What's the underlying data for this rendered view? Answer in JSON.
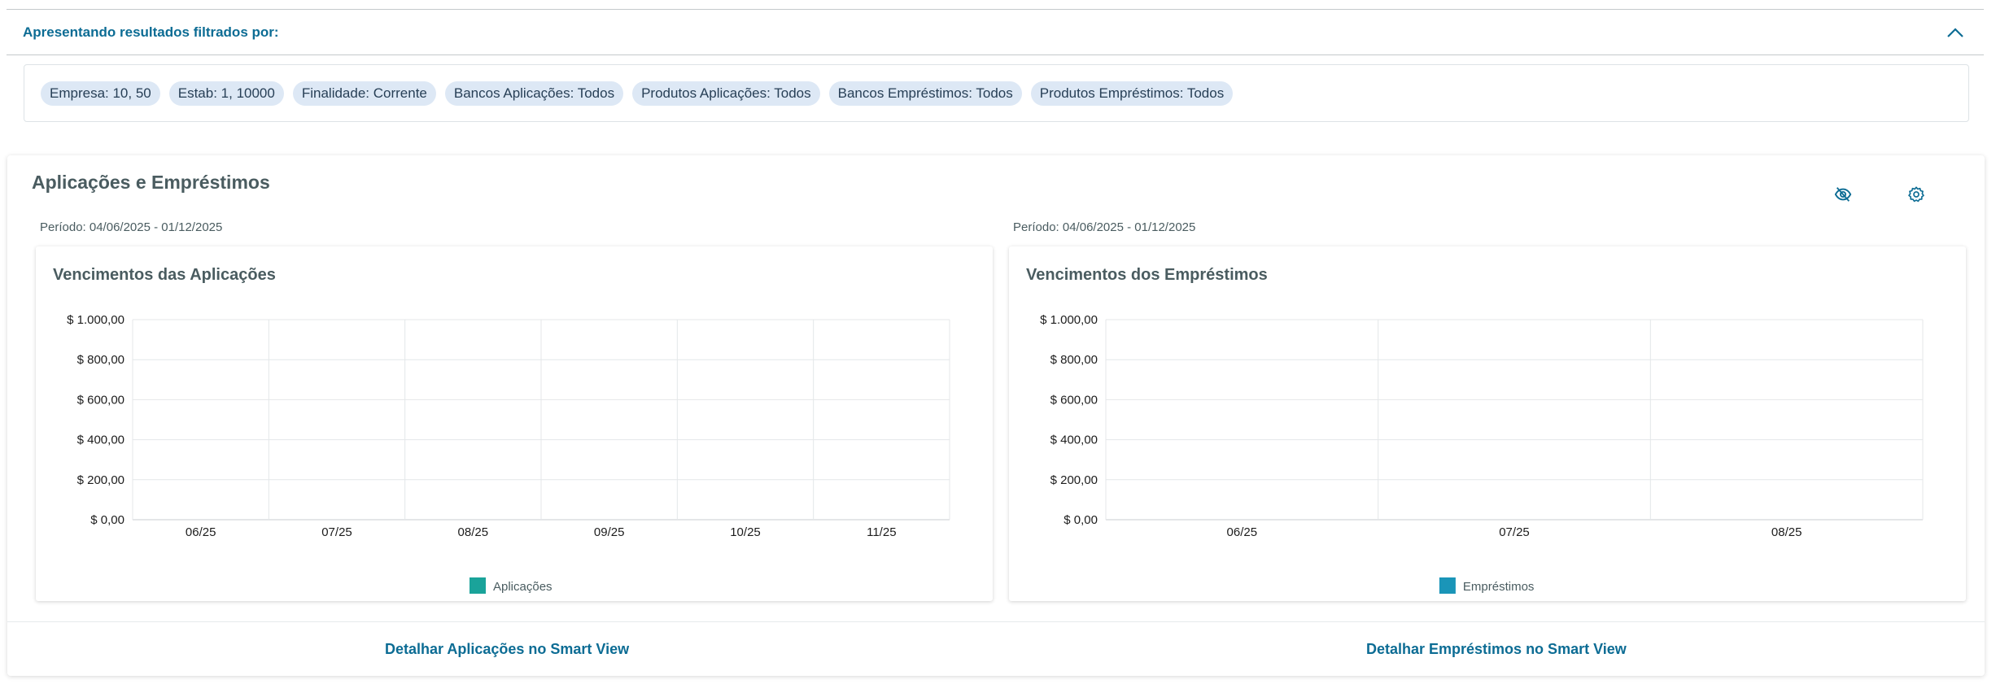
{
  "filter": {
    "title": "Apresentando resultados filtrados por:",
    "tags": [
      "Empresa: 10, 50",
      "Estab: 1, 10000",
      "Finalidade: Corrente",
      "Bancos Aplicações: Todos",
      "Produtos Aplicações: Todos",
      "Bancos Empréstimos: Todos",
      "Produtos Empréstimos: Todos"
    ]
  },
  "card": {
    "title": "Aplicações e Empréstimos",
    "icons": [
      "eye-off-icon",
      "gear-icon"
    ],
    "period_left": "Período: 04/06/2025 - 01/12/2025",
    "period_right": "Período: 04/06/2025 - 01/12/2025",
    "link_left": "Detalhar Aplicações no Smart View",
    "link_right": "Detalhar Empréstimos no Smart View"
  },
  "chart_data": [
    {
      "type": "bar",
      "title": "Vencimentos das Aplicações",
      "categories": [
        "06/25",
        "07/25",
        "08/25",
        "09/25",
        "10/25",
        "11/25"
      ],
      "series": [
        {
          "name": "Aplicações",
          "values": [
            0,
            0,
            0,
            0,
            0,
            0
          ]
        }
      ],
      "ylim": [
        0,
        1000
      ],
      "yticks": [
        "$ 0,00",
        "$ 200,00",
        "$ 400,00",
        "$ 600,00",
        "$ 800,00",
        "$ 1.000,00"
      ],
      "color": "#1aa39a",
      "grid": true,
      "legend": "bottom"
    },
    {
      "type": "bar",
      "title": "Vencimentos dos Empréstimos",
      "categories": [
        "06/25",
        "07/25",
        "08/25"
      ],
      "series": [
        {
          "name": "Empréstimos",
          "values": [
            0,
            0,
            0
          ]
        }
      ],
      "ylim": [
        0,
        1000
      ],
      "yticks": [
        "$ 0,00",
        "$ 200,00",
        "$ 400,00",
        "$ 600,00",
        "$ 800,00",
        "$ 1.000,00"
      ],
      "color": "#1a95b8",
      "grid": true,
      "legend": "bottom"
    }
  ]
}
